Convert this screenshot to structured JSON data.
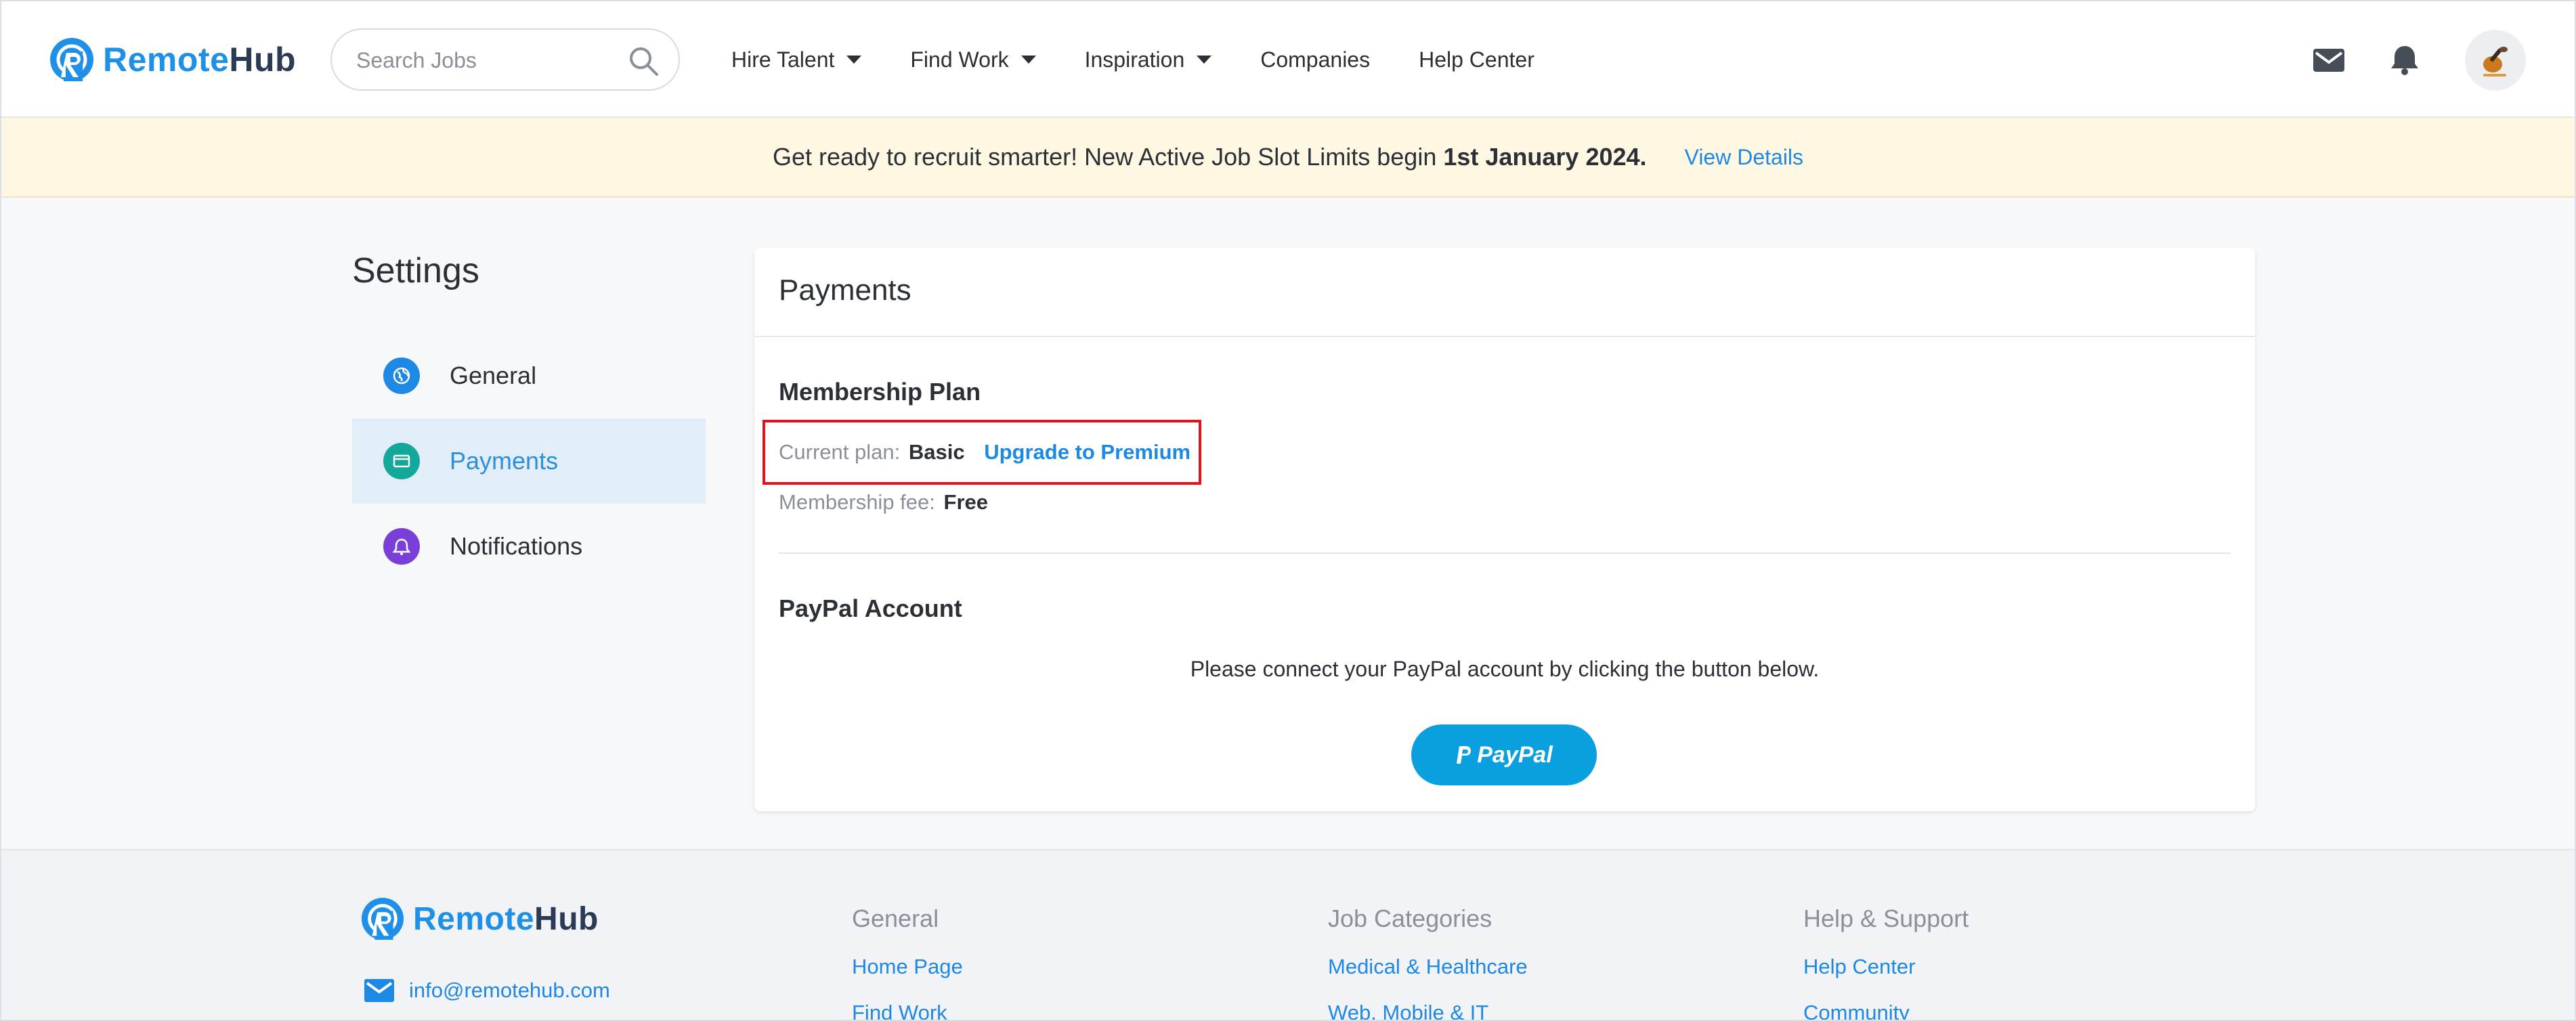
{
  "brand": {
    "name_part1": "Remote",
    "name_part2": "Hub",
    "accent": "#1e90e8",
    "dark": "#2b3a55"
  },
  "header": {
    "search_placeholder": "Search Jobs",
    "nav": [
      {
        "label": "Hire Talent",
        "dropdown": true
      },
      {
        "label": "Find Work",
        "dropdown": true
      },
      {
        "label": "Inspiration",
        "dropdown": true
      },
      {
        "label": "Companies",
        "dropdown": false
      },
      {
        "label": "Help Center",
        "dropdown": false
      }
    ],
    "icons": [
      "mail-icon",
      "bell-icon",
      "avatar"
    ]
  },
  "banner": {
    "message_prefix": "Get ready to recruit smarter! New Active Job Slot Limits begin ",
    "message_bold": "1st January 2024.",
    "link_label": "View Details"
  },
  "settings": {
    "title": "Settings",
    "items": [
      {
        "label": "General",
        "icon": "globe-icon",
        "color": "#1e88e5"
      },
      {
        "label": "Payments",
        "icon": "card-icon",
        "color": "#12a89a",
        "active": true
      },
      {
        "label": "Notifications",
        "icon": "bell-icon",
        "color": "#7b3fd9"
      }
    ]
  },
  "payments": {
    "title": "Payments",
    "membership": {
      "title": "Membership Plan",
      "current_plan_label": "Current plan:",
      "current_plan_value": "Basic",
      "upgrade_label": "Upgrade to Premium",
      "fee_label": "Membership fee:",
      "fee_value": "Free"
    },
    "paypal": {
      "title": "PayPal Account",
      "instruction": "Please connect your PayPal account by clicking the button below.",
      "button_label": "PayPal",
      "button_color": "#0aa0df"
    }
  },
  "footer": {
    "email": "info@remotehub.com",
    "columns": [
      {
        "heading": "General",
        "links": [
          "Home Page",
          "Find Work"
        ]
      },
      {
        "heading": "Job Categories",
        "links": [
          "Medical & Healthcare",
          "Web, Mobile & IT"
        ]
      },
      {
        "heading": "Help & Support",
        "links": [
          "Help Center",
          "Community"
        ]
      }
    ]
  }
}
